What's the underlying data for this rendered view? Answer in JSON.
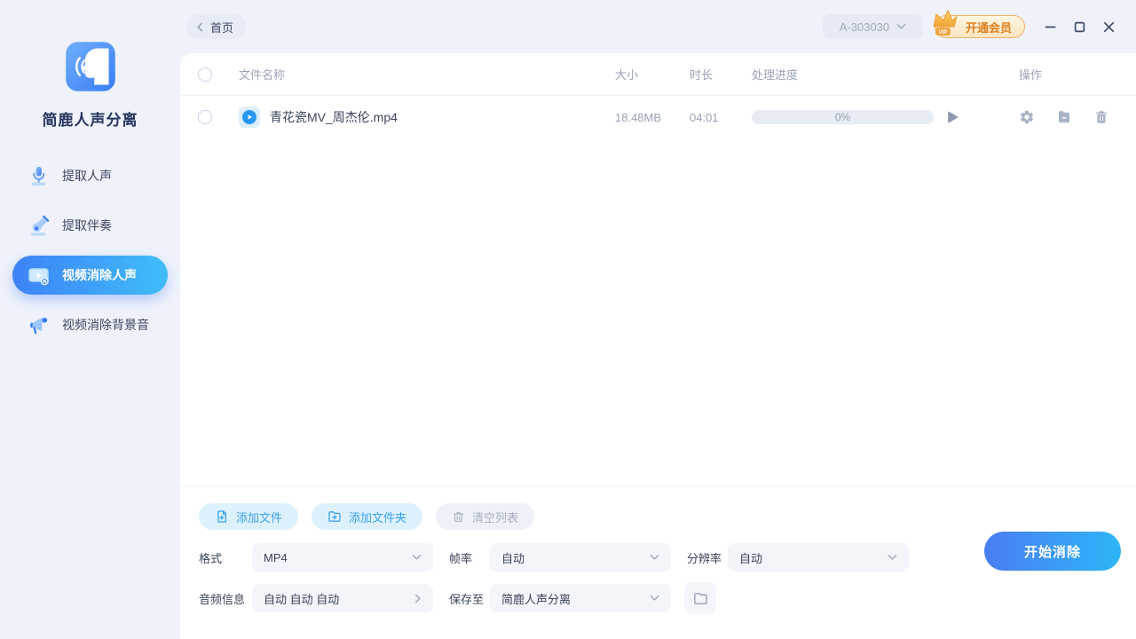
{
  "app": {
    "name": "简鹿人声分离"
  },
  "colors": {
    "sidebar_bg": "#eff2fb",
    "accent": "#2e9bf7",
    "active_gradient": [
      "#3e82f7",
      "#3fbdf8"
    ],
    "start_gradient": [
      "#4a7df2",
      "#2eb6f9"
    ],
    "vip_text": "#e07f1f"
  },
  "sidebar": {
    "items": [
      {
        "label": "提取人声",
        "icon": "microphone-icon",
        "active": false
      },
      {
        "label": "提取伴奏",
        "icon": "guitar-icon",
        "active": false
      },
      {
        "label": "视频消除人声",
        "icon": "video-screen-icon",
        "active": true
      },
      {
        "label": "视频消除背景音",
        "icon": "megaphone-icon",
        "active": false
      }
    ]
  },
  "topbar": {
    "back_label": "首页",
    "account_id": "A-303030",
    "vip_badge": "VIP",
    "vip_label": "开通会员"
  },
  "table": {
    "headers": {
      "name": "文件名称",
      "size": "大小",
      "duration": "时长",
      "progress": "处理进度",
      "actions": "操作"
    },
    "rows": [
      {
        "name": "青花瓷MV_周杰伦.mp4",
        "size": "18.48MB",
        "duration": "04:01",
        "progress_text": "0%",
        "progress_percent": 0
      }
    ]
  },
  "footer": {
    "buttons": {
      "add_file": "添加文件",
      "add_folder": "添加文件夹",
      "clear_list": "清空列表"
    },
    "fields": {
      "format": {
        "label": "格式",
        "value": "MP4"
      },
      "framerate": {
        "label": "帧率",
        "value": "自动"
      },
      "resolution": {
        "label": "分辨率",
        "value": "自动"
      },
      "audio_info": {
        "label": "音频信息",
        "value": "自动 自动 自动"
      },
      "save_to": {
        "label": "保存至",
        "value": "简鹿人声分离"
      }
    },
    "start_button": "开始消除"
  }
}
